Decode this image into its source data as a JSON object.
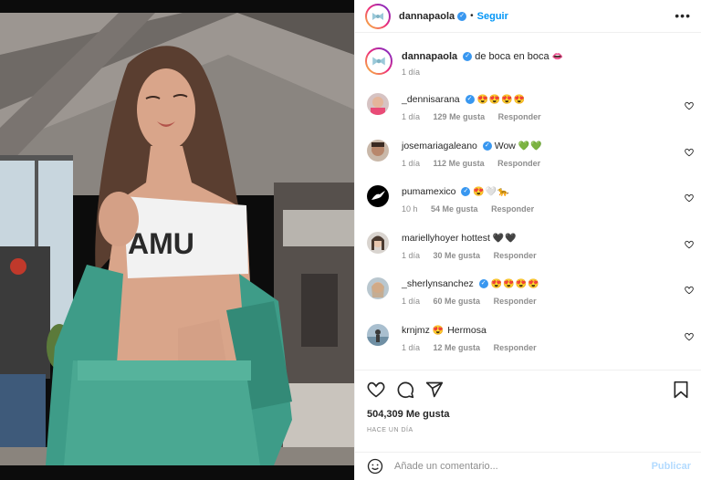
{
  "post": {
    "username": "dannapaola",
    "follow_label": "Seguir",
    "more_icon": "more-horizontal-icon"
  },
  "caption": {
    "username": "dannapaola",
    "text": "de boca en boca",
    "emoji": "👄",
    "time": "1 día"
  },
  "comments": [
    {
      "username": "_dennisarana",
      "text": "",
      "emoji": "😍😍😍😍",
      "time": "1 día",
      "likes": "129 Me gusta",
      "reply": "Responder",
      "verified": true
    },
    {
      "username": "josemariagaleano",
      "text": "Wow",
      "emoji": "💚💚",
      "time": "1 día",
      "likes": "112 Me gusta",
      "reply": "Responder",
      "verified": true
    },
    {
      "username": "pumamexico",
      "text": "",
      "emoji": "😍🤍🐆",
      "time": "10 h",
      "likes": "54 Me gusta",
      "reply": "Responder",
      "verified": true
    },
    {
      "username": "mariellyhoyer",
      "text": "hottest",
      "emoji": "🖤🖤",
      "time": "1 día",
      "likes": "30 Me gusta",
      "reply": "Responder",
      "verified": false
    },
    {
      "username": "_sherlynsanchez",
      "text": "",
      "emoji": "😍😍😍😍",
      "time": "1 día",
      "likes": "60 Me gusta",
      "reply": "Responder",
      "verified": true
    },
    {
      "username": "krnjmz",
      "text": "Hermosa",
      "emoji": "😍",
      "time": "1 día",
      "likes": "12 Me gusta",
      "reply": "Responder",
      "verified": false
    }
  ],
  "actions": {
    "likes": "504,309 Me gusta",
    "ago": "HACE UN DÍA"
  },
  "add_comment": {
    "placeholder": "Añade un comentario...",
    "post_label": "Publicar"
  },
  "colors": {
    "link_blue": "#0095f6",
    "verified_blue": "#3897f0",
    "muted": "#8e8e8e",
    "outfit_green": "#3e9c88"
  }
}
